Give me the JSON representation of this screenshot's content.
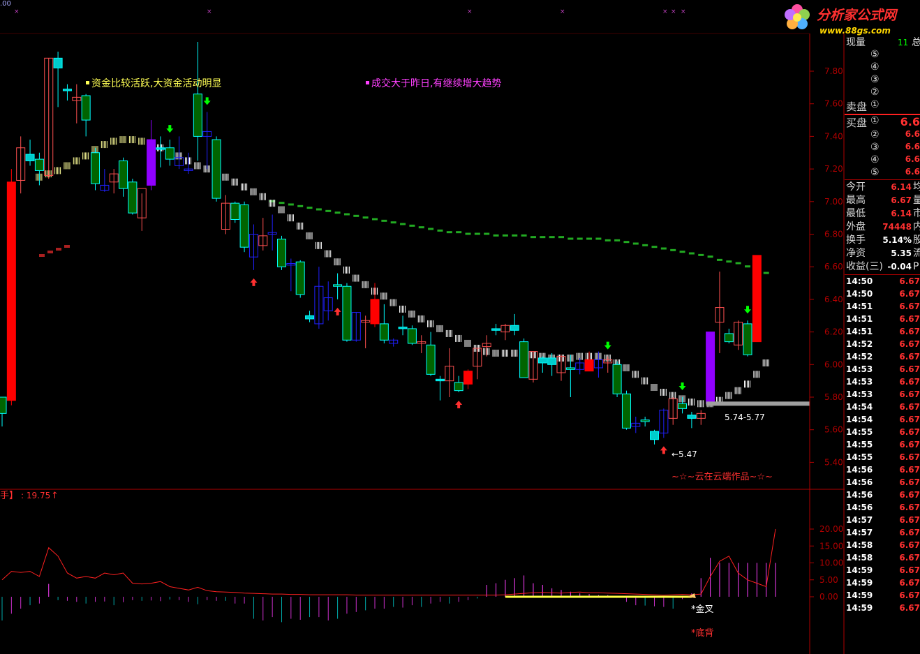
{
  "top_marker": ".00",
  "logo": {
    "name": "分析家公式网",
    "url": "www.88gs.com"
  },
  "notes": {
    "funds": "资金比较活跃,大资金活动明显",
    "volume": "成交大于昨日,有继续增大趋势",
    "range": "5.74-5.77",
    "low": "←5.47",
    "author": "~☆~云在云端作品~☆~",
    "gold_cross": "*金叉",
    "bottom_div": "*底背",
    "indicator_name": "手】",
    "indicator_value": ": 19.75",
    "indicator_arrow": "↑"
  },
  "colors": {
    "up": "#ff3030",
    "down": "#00ffff",
    "green_bar": "#006600",
    "axis": "#b00000",
    "panel_red": "#ff2020"
  },
  "quote_panel": {
    "now_volume_label": "现量",
    "now_volume_value": "11",
    "now_volume_extra": "总",
    "sell_label": "卖盘",
    "buy_label": "买盘",
    "level_marks": [
      "⑤",
      "④",
      "③",
      "②",
      "①"
    ],
    "buy_levels": [
      {
        "mark": "①",
        "price": "6.6"
      },
      {
        "mark": "②",
        "price": "6.6"
      },
      {
        "mark": "③",
        "price": "6.6"
      },
      {
        "mark": "④",
        "price": "6.6"
      },
      {
        "mark": "⑤",
        "price": "6.6"
      }
    ],
    "stats": [
      {
        "label": "今开",
        "value": "6.14",
        "extra": "均"
      },
      {
        "label": "最高",
        "value": "6.67",
        "extra": "量"
      },
      {
        "label": "最低",
        "value": "6.14",
        "extra": "市"
      },
      {
        "label": "外盘",
        "value": "74448",
        "extra": "内"
      },
      {
        "label": "换手",
        "value": "5.14%",
        "extra": "股"
      },
      {
        "label": "净资",
        "value": "5.35",
        "extra": "流"
      },
      {
        "label": "收益(三)",
        "value": "-0.04",
        "extra": "P"
      }
    ],
    "ticks": [
      {
        "time": "14:50",
        "price": "6.67"
      },
      {
        "time": "14:50",
        "price": "6.67"
      },
      {
        "time": "14:51",
        "price": "6.67"
      },
      {
        "time": "14:51",
        "price": "6.67"
      },
      {
        "time": "14:51",
        "price": "6.67"
      },
      {
        "time": "14:52",
        "price": "6.67"
      },
      {
        "time": "14:52",
        "price": "6.67"
      },
      {
        "time": "14:53",
        "price": "6.67"
      },
      {
        "time": "14:53",
        "price": "6.67"
      },
      {
        "time": "14:53",
        "price": "6.67"
      },
      {
        "time": "14:54",
        "price": "6.67"
      },
      {
        "time": "14:54",
        "price": "6.67"
      },
      {
        "time": "14:55",
        "price": "6.67"
      },
      {
        "time": "14:55",
        "price": "6.67"
      },
      {
        "time": "14:55",
        "price": "6.67"
      },
      {
        "time": "14:56",
        "price": "6.67"
      },
      {
        "time": "14:56",
        "price": "6.67"
      },
      {
        "time": "14:56",
        "price": "6.67"
      },
      {
        "time": "14:56",
        "price": "6.67"
      },
      {
        "time": "14:57",
        "price": "6.67"
      },
      {
        "time": "14:57",
        "price": "6.67"
      },
      {
        "time": "14:58",
        "price": "6.67"
      },
      {
        "time": "14:58",
        "price": "6.67"
      },
      {
        "time": "14:59",
        "price": "6.67"
      },
      {
        "time": "14:59",
        "price": "6.67"
      },
      {
        "time": "14:59",
        "price": "6.67"
      },
      {
        "time": "14:59",
        "price": "6.67"
      }
    ]
  },
  "chart_data": [
    {
      "type": "candlestick",
      "y_ticks": [
        "7.80",
        "7.60",
        "7.40",
        "7.20",
        "7.00",
        "6.80",
        "6.60",
        "6.40",
        "6.20",
        "6.00",
        "5.80",
        "5.60",
        "5.40"
      ],
      "ylim": [
        5.34,
        7.98
      ],
      "candles": [
        {
          "o": 5.7,
          "h": 5.8,
          "l": 5.62,
          "c": 5.8,
          "k": "g"
        },
        {
          "o": 5.78,
          "h": 7.2,
          "l": 5.75,
          "c": 7.12,
          "k": "r"
        },
        {
          "o": 7.13,
          "h": 7.4,
          "l": 7.05,
          "c": 7.33,
          "k": "h"
        },
        {
          "o": 7.29,
          "h": 7.38,
          "l": 7.22,
          "c": 7.25,
          "k": "c"
        },
        {
          "o": 7.19,
          "h": 7.3,
          "l": 7.1,
          "c": 7.26,
          "k": "g"
        },
        {
          "o": 7.16,
          "h": 7.88,
          "l": 7.14,
          "c": 7.88,
          "k": "h"
        },
        {
          "o": 7.88,
          "h": 7.92,
          "l": 7.58,
          "c": 7.82,
          "k": "c"
        },
        {
          "o": 7.69,
          "h": 7.72,
          "l": 7.62,
          "c": 7.68,
          "k": "c"
        },
        {
          "o": 7.64,
          "h": 7.72,
          "l": 7.48,
          "c": 7.62,
          "k": "h"
        },
        {
          "o": 7.65,
          "h": 7.66,
          "l": 7.4,
          "c": 7.5,
          "k": "g"
        },
        {
          "o": 7.3,
          "h": 7.33,
          "l": 7.07,
          "c": 7.11,
          "k": "g"
        },
        {
          "o": 7.1,
          "h": 7.2,
          "l": 7.06,
          "c": 7.07,
          "k": "b"
        },
        {
          "o": 7.12,
          "h": 7.2,
          "l": 7.05,
          "c": 7.17,
          "k": "h"
        },
        {
          "o": 7.08,
          "h": 7.27,
          "l": 7.03,
          "c": 7.25,
          "k": "g"
        },
        {
          "o": 7.12,
          "h": 7.14,
          "l": 6.92,
          "c": 6.93,
          "k": "g"
        },
        {
          "o": 6.9,
          "h": 7.05,
          "l": 6.82,
          "c": 7.08,
          "k": "h"
        },
        {
          "o": 7.1,
          "h": 7.5,
          "l": 7.07,
          "c": 7.38,
          "k": "v"
        },
        {
          "o": 7.32,
          "h": 7.4,
          "l": 7.21,
          "c": 7.33,
          "k": "c"
        },
        {
          "o": 7.33,
          "h": 7.38,
          "l": 7.22,
          "c": 7.26,
          "k": "g"
        },
        {
          "o": 7.27,
          "h": 7.4,
          "l": 7.2,
          "c": 7.22,
          "k": "b"
        },
        {
          "o": 7.2,
          "h": 7.3,
          "l": 7.17,
          "c": 7.19,
          "k": "b"
        },
        {
          "o": 7.4,
          "h": 7.98,
          "l": 7.25,
          "c": 7.66,
          "k": "g"
        },
        {
          "o": 7.4,
          "h": 7.55,
          "l": 7.2,
          "c": 7.43,
          "k": "b"
        },
        {
          "o": 7.38,
          "h": 7.4,
          "l": 7.0,
          "c": 7.02,
          "k": "g"
        },
        {
          "o": 6.99,
          "h": 7.04,
          "l": 6.8,
          "c": 6.83,
          "k": "h"
        },
        {
          "o": 6.99,
          "h": 7.0,
          "l": 6.87,
          "c": 6.89,
          "k": "g"
        },
        {
          "o": 6.98,
          "h": 7.0,
          "l": 6.69,
          "c": 6.72,
          "k": "g"
        },
        {
          "o": 6.8,
          "h": 6.86,
          "l": 6.58,
          "c": 6.66,
          "k": "b"
        },
        {
          "o": 6.73,
          "h": 6.9,
          "l": 6.7,
          "c": 6.79,
          "k": "h"
        },
        {
          "o": 6.8,
          "h": 6.92,
          "l": 6.7,
          "c": 6.81,
          "k": "b"
        },
        {
          "o": 6.77,
          "h": 6.79,
          "l": 6.58,
          "c": 6.6,
          "k": "g"
        },
        {
          "o": 6.61,
          "h": 6.65,
          "l": 6.45,
          "c": 6.62,
          "k": "b"
        },
        {
          "o": 6.63,
          "h": 6.64,
          "l": 6.41,
          "c": 6.43,
          "k": "g"
        },
        {
          "o": 6.3,
          "h": 6.33,
          "l": 6.26,
          "c": 6.28,
          "k": "c"
        },
        {
          "o": 6.25,
          "h": 6.6,
          "l": 6.22,
          "c": 6.48,
          "k": "b"
        },
        {
          "o": 6.33,
          "h": 6.51,
          "l": 6.27,
          "c": 6.41,
          "k": "b"
        },
        {
          "o": 6.49,
          "h": 6.56,
          "l": 6.4,
          "c": 6.48,
          "k": "g"
        },
        {
          "o": 6.48,
          "h": 6.5,
          "l": 6.14,
          "c": 6.15,
          "k": "g"
        },
        {
          "o": 6.15,
          "h": 6.32,
          "l": 6.14,
          "c": 6.32,
          "k": "b"
        },
        {
          "o": 6.26,
          "h": 6.3,
          "l": 6.1,
          "c": 6.27,
          "k": "h"
        },
        {
          "o": 6.4,
          "h": 6.5,
          "l": 6.23,
          "c": 6.25,
          "k": "r"
        },
        {
          "o": 6.25,
          "h": 6.37,
          "l": 6.13,
          "c": 6.15,
          "k": "g"
        },
        {
          "o": 6.15,
          "h": 6.16,
          "l": 6.11,
          "c": 6.13,
          "k": "b"
        },
        {
          "o": 6.22,
          "h": 6.3,
          "l": 6.18,
          "c": 6.23,
          "k": "c"
        },
        {
          "o": 6.22,
          "h": 6.24,
          "l": 6.12,
          "c": 6.13,
          "k": "g"
        },
        {
          "o": 6.14,
          "h": 6.18,
          "l": 6.07,
          "c": 6.13,
          "k": "h"
        },
        {
          "o": 6.12,
          "h": 6.2,
          "l": 5.93,
          "c": 5.94,
          "k": "g"
        },
        {
          "o": 5.91,
          "h": 5.93,
          "l": 5.78,
          "c": 5.9,
          "k": "c"
        },
        {
          "o": 5.9,
          "h": 6.1,
          "l": 5.8,
          "c": 5.99,
          "k": "h"
        },
        {
          "o": 5.89,
          "h": 5.93,
          "l": 5.83,
          "c": 5.84,
          "k": "g"
        },
        {
          "o": 5.88,
          "h": 5.97,
          "l": 5.85,
          "c": 5.96,
          "k": "r"
        },
        {
          "o": 5.99,
          "h": 6.1,
          "l": 5.91,
          "c": 6.1,
          "k": "h"
        },
        {
          "o": 6.11,
          "h": 6.18,
          "l": 6.05,
          "c": 6.13,
          "k": "h"
        },
        {
          "o": 6.22,
          "h": 6.25,
          "l": 6.18,
          "c": 6.21,
          "k": "c"
        },
        {
          "o": 6.2,
          "h": 6.25,
          "l": 6.15,
          "c": 6.24,
          "k": "h"
        },
        {
          "o": 6.24,
          "h": 6.31,
          "l": 6.18,
          "c": 6.21,
          "k": "c"
        },
        {
          "o": 6.14,
          "h": 6.16,
          "l": 5.96,
          "c": 5.92,
          "k": "g"
        },
        {
          "o": 5.91,
          "h": 6.08,
          "l": 5.89,
          "c": 6.08,
          "k": "h"
        },
        {
          "o": 6.04,
          "h": 6.05,
          "l": 5.95,
          "c": 6.01,
          "k": "c"
        },
        {
          "o": 6.04,
          "h": 6.07,
          "l": 5.93,
          "c": 6.0,
          "k": "c"
        },
        {
          "o": 5.95,
          "h": 6.06,
          "l": 5.9,
          "c": 6.05,
          "k": "h"
        },
        {
          "o": 5.98,
          "h": 6.06,
          "l": 5.8,
          "c": 5.97,
          "k": "g"
        },
        {
          "o": 5.97,
          "h": 6.04,
          "l": 5.94,
          "c": 6.01,
          "k": "b"
        },
        {
          "o": 6.03,
          "h": 6.08,
          "l": 5.96,
          "c": 5.96,
          "k": "r"
        },
        {
          "o": 5.98,
          "h": 6.08,
          "l": 5.92,
          "c": 6.03,
          "k": "b"
        },
        {
          "o": 6.03,
          "h": 6.05,
          "l": 5.95,
          "c": 6.01,
          "k": "h"
        },
        {
          "o": 6.0,
          "h": 6.02,
          "l": 5.8,
          "c": 5.82,
          "k": "g"
        },
        {
          "o": 5.82,
          "h": 5.84,
          "l": 5.6,
          "c": 5.61,
          "k": "g"
        },
        {
          "o": 5.64,
          "h": 5.68,
          "l": 5.58,
          "c": 5.62,
          "k": "b"
        },
        {
          "o": 5.66,
          "h": 5.68,
          "l": 5.62,
          "c": 5.65,
          "k": "g"
        },
        {
          "o": 5.59,
          "h": 5.6,
          "l": 5.51,
          "c": 5.54,
          "k": "c"
        },
        {
          "o": 5.72,
          "h": 5.73,
          "l": 5.55,
          "c": 5.58,
          "k": "b"
        },
        {
          "o": 5.67,
          "h": 5.8,
          "l": 5.63,
          "c": 5.79,
          "k": "h"
        },
        {
          "o": 5.73,
          "h": 5.8,
          "l": 5.7,
          "c": 5.76,
          "k": "g"
        },
        {
          "o": 5.69,
          "h": 5.71,
          "l": 5.61,
          "c": 5.67,
          "k": "c"
        },
        {
          "o": 5.67,
          "h": 5.72,
          "l": 5.63,
          "c": 5.7,
          "k": "h"
        },
        {
          "o": 5.76,
          "h": 6.2,
          "l": 5.75,
          "c": 6.2,
          "k": "v"
        },
        {
          "o": 6.26,
          "h": 6.57,
          "l": 6.07,
          "c": 6.35,
          "k": "h"
        },
        {
          "o": 6.19,
          "h": 6.22,
          "l": 6.13,
          "c": 6.14,
          "k": "g"
        },
        {
          "o": 6.12,
          "h": 6.27,
          "l": 6.09,
          "c": 6.26,
          "k": "h"
        },
        {
          "o": 6.25,
          "h": 6.27,
          "l": 6.05,
          "c": 6.06,
          "k": "g"
        },
        {
          "o": 6.14,
          "h": 6.67,
          "l": 6.14,
          "c": 6.67,
          "k": "r"
        }
      ],
      "ma_dotted_white": [
        null,
        null,
        null,
        null,
        7.15,
        7.17,
        7.19,
        7.22,
        7.25,
        7.28,
        7.32,
        7.35,
        7.37,
        7.38,
        7.38,
        7.37,
        7.35,
        7.33,
        7.3,
        7.28,
        7.25,
        7.22,
        7.2,
        7.18,
        7.15,
        7.12,
        7.09,
        7.06,
        7.03,
        6.99,
        6.95,
        6.9,
        6.85,
        6.79,
        6.73,
        6.68,
        6.63,
        6.58,
        6.53,
        6.49,
        6.45,
        6.42,
        6.38,
        6.34,
        6.31,
        6.28,
        6.25,
        6.22,
        6.19,
        6.16,
        6.13,
        6.1,
        6.08,
        6.07,
        6.07,
        6.07,
        6.07,
        6.06,
        6.05,
        6.04,
        6.04,
        6.04,
        6.05,
        6.05,
        6.05,
        6.04,
        6.01,
        5.98,
        5.94,
        5.9,
        5.86,
        5.83,
        5.81,
        5.79,
        5.77,
        5.76,
        5.76,
        5.78,
        5.81,
        5.84,
        5.88,
        5.94,
        6.01
      ],
      "ma_long_green": [
        null,
        null,
        null,
        null,
        null,
        null,
        null,
        null,
        null,
        null,
        null,
        null,
        null,
        null,
        null,
        null,
        null,
        null,
        null,
        null,
        null,
        null,
        null,
        null,
        null,
        null,
        null,
        null,
        null,
        7.0,
        6.99,
        6.98,
        6.97,
        6.96,
        6.95,
        6.94,
        6.93,
        6.92,
        6.91,
        6.9,
        6.89,
        6.88,
        6.87,
        6.86,
        6.85,
        6.84,
        6.83,
        6.82,
        6.81,
        6.81,
        6.8,
        6.8,
        6.8,
        6.79,
        6.79,
        6.79,
        6.79,
        6.78,
        6.78,
        6.78,
        6.78,
        6.77,
        6.77,
        6.77,
        6.77,
        6.76,
        6.76,
        6.75,
        6.74,
        6.73,
        6.72,
        6.71,
        6.7,
        6.69,
        6.68,
        6.67,
        6.66,
        6.64,
        6.63,
        6.62,
        6.6,
        6.58,
        6.56
      ],
      "support_level": 5.76,
      "up_arrows_at": [
        27,
        36,
        49,
        71
      ],
      "down_arrows_at": [
        18,
        22,
        65,
        73,
        80
      ]
    },
    {
      "type": "bar+line",
      "y_ticks": [
        "20.00",
        "15.00",
        "10.00",
        "5.00",
        "0.00"
      ],
      "ylim": [
        -8,
        21
      ],
      "line": [
        5.0,
        7.5,
        7.2,
        7.5,
        6.0,
        14.5,
        12.0,
        7.0,
        5.5,
        6.0,
        5.5,
        7.0,
        6.5,
        7.0,
        4.0,
        3.8,
        4.0,
        4.5,
        3.0,
        2.5,
        2.0,
        2.8,
        1.8,
        1.5,
        1.4,
        1.3,
        1.1,
        1.0,
        0.9,
        0.8,
        0.8,
        0.7,
        0.7,
        0.6,
        0.6,
        0.6,
        0.6,
        0.6,
        0.5,
        0.5,
        0.5,
        0.5,
        0.5,
        0.5,
        0.5,
        0.5,
        0.5,
        0.5,
        0.5,
        0.5,
        0.5,
        0.5,
        0.5,
        0.5,
        0.6,
        0.8,
        1.0,
        1.2,
        1.3,
        1.2,
        1.1,
        1.3,
        1.4,
        1.2,
        1.2,
        1.1,
        1.0,
        0.9,
        0.8,
        0.7,
        0.6,
        0.5,
        0.6,
        0.7,
        0.6,
        0.8,
        6.0,
        10.5,
        12.0,
        7.0,
        5.0,
        4.0,
        3.0,
        20.0
      ],
      "bars": [
        -7.0,
        -5.0,
        -3.5,
        -2.5,
        -2.0,
        3.8,
        -1.0,
        -1.2,
        -1.5,
        -2.0,
        -1.5,
        -1.4,
        -2.5,
        -1.6,
        -1.0,
        -1.2,
        -1.1,
        -1.3,
        -0.8,
        -1.0,
        -1.5,
        -2.2,
        -1.0,
        -1.2,
        -1.2,
        -2.0,
        -2.0,
        -6.5,
        -7.0,
        -6.0,
        -7.5,
        -6.5,
        -6.8,
        -6.0,
        -6.0,
        -7.0,
        -6.5,
        -5.0,
        -4.5,
        -4.0,
        -3.5,
        -3.5,
        -3.0,
        -3.2,
        -2.5,
        -3.0,
        -2.0,
        -1.5,
        -2.0,
        -1.5,
        -1.0,
        -0.5,
        3.5,
        4.0,
        5.0,
        5.5,
        6.3,
        4.0,
        3.5,
        2.5,
        2.0,
        1.5,
        1.0,
        0.8,
        0.5,
        0.5,
        0.3,
        -1.5,
        -2.5,
        -2.6,
        -2.8,
        -3.0,
        -3.5,
        -0.7,
        1.0,
        5.5,
        11.5,
        10.0,
        10.0,
        10.0,
        10.0,
        10.0,
        10.0,
        10.0
      ]
    }
  ]
}
